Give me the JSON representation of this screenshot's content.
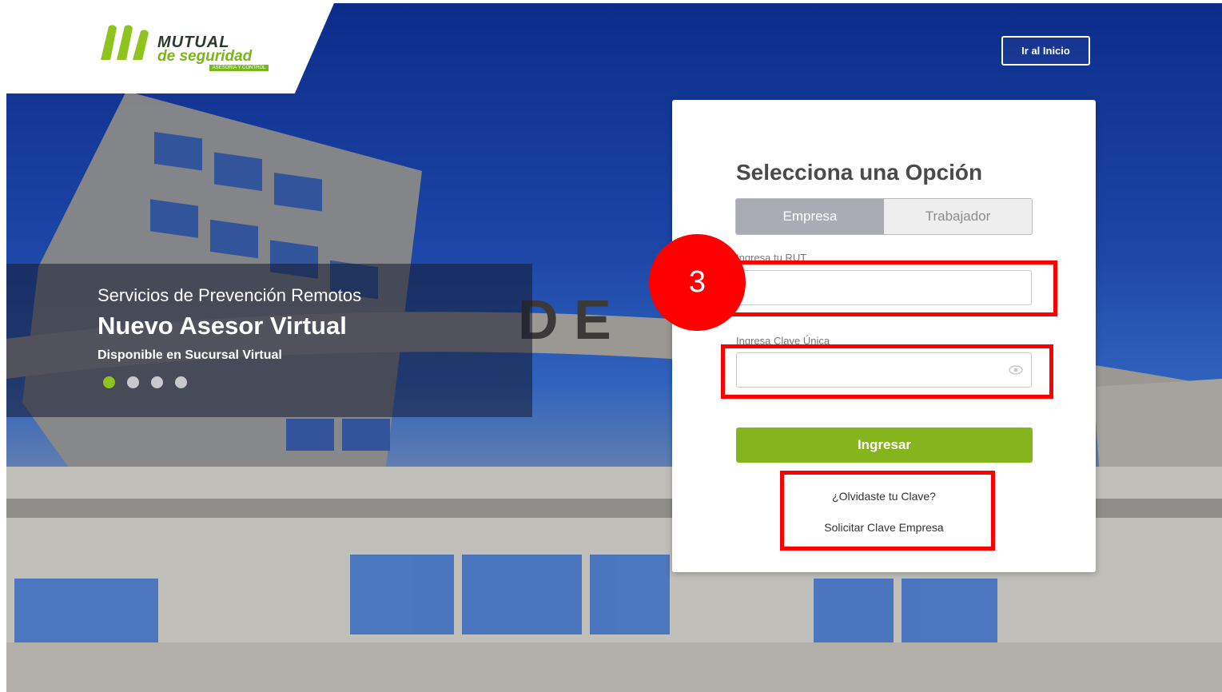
{
  "brand": {
    "line1": "MUTUAL",
    "line2": "de seguridad",
    "tag": "ASESORÍA Y CONTROL",
    "colors": {
      "green": "#8fc31f",
      "dark": "#2b3a2e"
    }
  },
  "header": {
    "home_button": "Ir al Inicio"
  },
  "promo": {
    "kicker": "Servicios de Prevención Remotos",
    "headline": "Nuevo Asesor Virtual",
    "sub": "Disponible en Sucursal Virtual",
    "slides": 4,
    "active_slide": 1
  },
  "login": {
    "title": "Selecciona una Opción",
    "tabs": [
      {
        "label": "Empresa",
        "active": true
      },
      {
        "label": "Trabajador",
        "active": false
      }
    ],
    "rut_label": "Ingresa tu RUT",
    "rut_value": "",
    "password_label": "Ingresa Clave Única",
    "password_value": "",
    "password_toggle_icon": "eye-icon",
    "submit_label": "Ingresar",
    "forgot_link": "¿Olvidaste tu Clave?",
    "request_link": "Solicitar Clave Empresa"
  },
  "annotation": {
    "step_number": "3",
    "color": "#ff0000"
  }
}
